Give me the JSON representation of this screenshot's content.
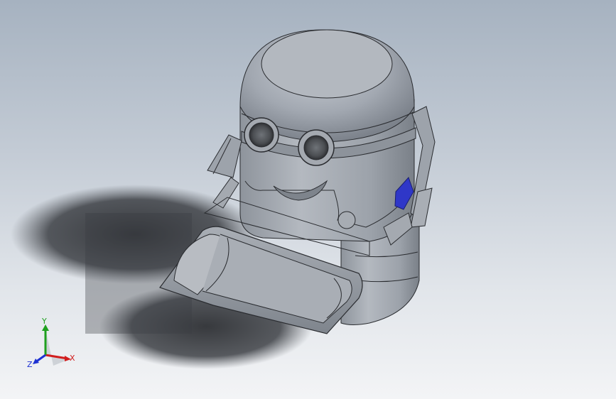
{
  "triad": {
    "x_label": "X",
    "y_label": "Y",
    "z_label": "Z",
    "x_color": "#d21e1e",
    "y_color": "#1ea01e",
    "z_color": "#1e32d2"
  },
  "model": {
    "body_color": "#9aa0a8",
    "accent_color": "#2f37c8",
    "shadow_color": "#3a3d42"
  }
}
